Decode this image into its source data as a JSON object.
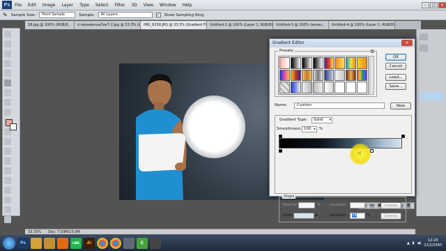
{
  "menubar": {
    "app_logo": "Ps",
    "items": [
      "File",
      "Edit",
      "Image",
      "Layer",
      "Type",
      "Select",
      "Filter",
      "3D",
      "View",
      "Window",
      "Help"
    ]
  },
  "options_bar": {
    "sample_size_label": "Sample Size:",
    "sample_size_value": "Point Sample",
    "sample_label": "Sample:",
    "sample_value": "All Layers",
    "show_ring_label": "Show Sampling Ring",
    "show_ring_checked": "✓"
  },
  "tabs": [
    {
      "label": "18.jpg @ 100% (RGB/8...",
      "active": false
    },
    {
      "label": "ถ่ายทอดสดบอลไทย7-2.jpg @ 33.3% (Layer 0, ...",
      "active": false
    },
    {
      "label": "IMG_6158.JPG @ 33.3% (Gradient Fill 1, RGB/8) *",
      "active": true
    },
    {
      "label": "Untitled-2 @ 100% (Layer 1, RGB/8)",
      "active": false
    },
    {
      "label": "Untitled-3 @ 100% (ทดลอง...",
      "active": false
    },
    {
      "label": "Untitled-4 @ 100% (Layer 1, RGB/8)",
      "active": false
    }
  ],
  "status_bar": {
    "zoom": "33.33%",
    "doc": "Doc: 7.03M/15.0M"
  },
  "gradient_editor": {
    "title": "Gradient Editor",
    "presets_label": "Presets",
    "buttons": {
      "ok": "OK",
      "cancel": "Cancel",
      "load": "Load...",
      "save": "Save...",
      "new": "New"
    },
    "name_label": "Name:",
    "name_value": "Custom",
    "gradient_type_label": "Gradient Type:",
    "gradient_type_value": "Solid",
    "smoothness_label": "Smoothness:",
    "smoothness_value": "100",
    "smoothness_unit": "%",
    "stops_label": "Stops",
    "opacity_label": "Opacity:",
    "opacity_unit": "%",
    "location_label": "Location:",
    "location_unit": "%",
    "delete_label": "Delete",
    "color_label": "Color:",
    "color_location_label": "Location:",
    "color_location_value": "75",
    "color_location_unit": "%",
    "color_delete_label": "Delete"
  },
  "taskbar": {
    "apps": [
      {
        "name": "photoshop",
        "label": "Ps",
        "color": "#1d3a66"
      },
      {
        "name": "explorer",
        "label": "",
        "color": "#d8a23a"
      },
      {
        "name": "folder",
        "label": "",
        "color": "#c59030"
      },
      {
        "name": "media",
        "label": "",
        "color": "#e06a10"
      },
      {
        "name": "line",
        "label": "LINE",
        "color": "#20b54a"
      },
      {
        "name": "illustrator",
        "label": "Ai",
        "color": "#3b1d08"
      },
      {
        "name": "chrome",
        "label": "",
        "color": "#3a8ee6"
      },
      {
        "name": "chrome2",
        "label": "",
        "color": "#e34133"
      },
      {
        "name": "app-gray",
        "label": "",
        "color": "#606a74"
      },
      {
        "name": "camtasia",
        "label": "C",
        "color": "#45a43a"
      },
      {
        "name": "app-dark",
        "label": "",
        "color": "#444"
      }
    ],
    "clock_time": "12:24",
    "clock_date": "21/2/2560"
  }
}
